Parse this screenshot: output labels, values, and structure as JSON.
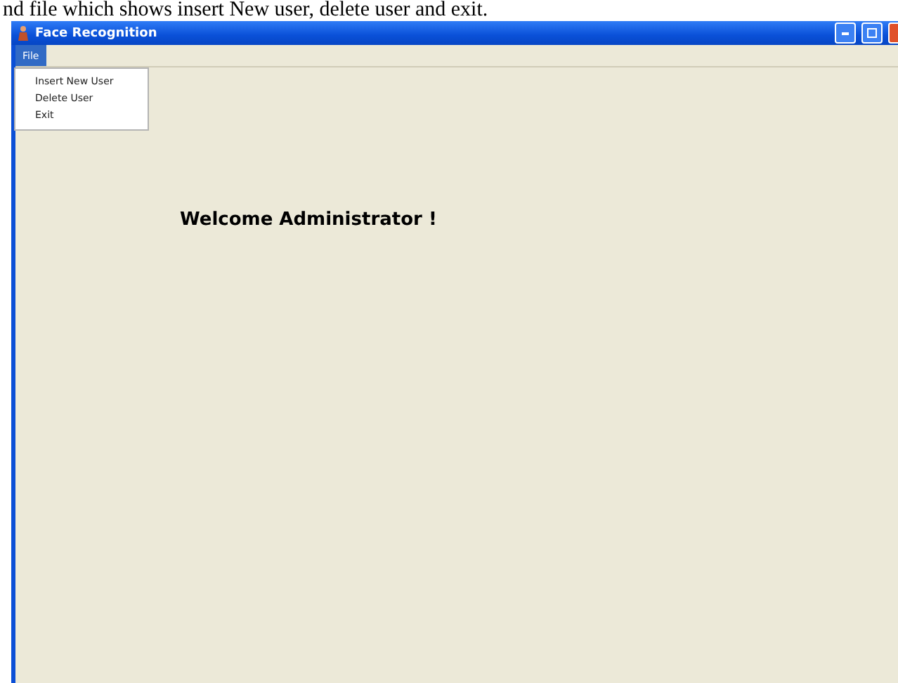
{
  "caption": "nd file which shows insert New user, delete user and exit.",
  "window": {
    "title": "Face Recognition"
  },
  "menu_bar": [
    {
      "label": "File",
      "selected": true
    }
  ],
  "menu": {
    "items": [
      "Insert New User",
      "Delete User",
      "Exit"
    ]
  },
  "content": {
    "heading": "Welcome Administrator !"
  }
}
